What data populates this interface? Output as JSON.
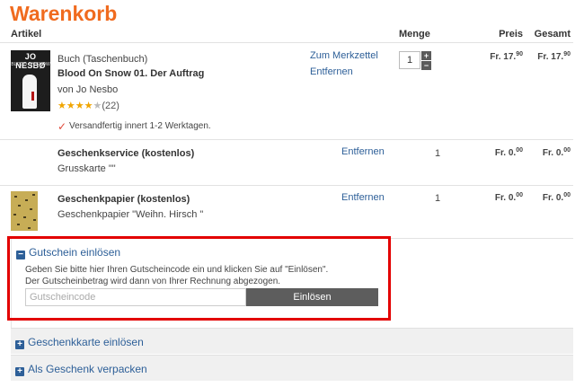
{
  "page": {
    "title": "Warenkorb"
  },
  "columns": {
    "artikel": "Artikel",
    "menge": "Menge",
    "preis": "Preis",
    "gesamt": "Gesamt"
  },
  "book": {
    "cover_author": "JO NESBØ",
    "cover_title": "BLOOD ON SNOW",
    "type": "Buch (Taschenbuch)",
    "title": "Blood On Snow 01. Der Auftrag",
    "author": "von Jo Nesbo",
    "rating": 4,
    "rating_max": 5,
    "rating_count": "(22)",
    "availability": "Versandfertig innert 1-2 Werktagen.",
    "wishlist_link": "Zum Merkzettel",
    "remove_link": "Entfernen",
    "quantity": "1",
    "price_main": "Fr. 17.",
    "price_cents": "90",
    "total_main": "Fr. 17.",
    "total_cents": "90"
  },
  "gift_service": {
    "title": "Geschenkservice (kostenlos)",
    "detail": "Grusskarte \"\"",
    "remove_link": "Entfernen",
    "quantity": "1",
    "price_main": "Fr. 0.",
    "price_cents": "00",
    "total_main": "Fr. 0.",
    "total_cents": "00"
  },
  "gift_paper": {
    "title": "Geschenkpapier (kostenlos)",
    "detail": "Geschenkpapier \"Weihn. Hirsch \"",
    "remove_link": "Entfernen",
    "quantity": "1",
    "price_main": "Fr. 0.",
    "price_cents": "00",
    "total_main": "Fr. 0.",
    "total_cents": "00"
  },
  "voucher": {
    "heading": "Gutschein einlösen",
    "hint_line1": "Geben Sie bitte hier Ihren Gutscheincode ein und klicken Sie auf \"Einlösen\".",
    "hint_line2": "Der Gutscheinbetrag wird dann von Ihrer Rechnung abgezogen.",
    "placeholder": "Gutscheincode",
    "button": "Einlösen"
  },
  "sections": {
    "gift_card": "Geschenkkarte einlösen",
    "gift_wrap": "Als Geschenk verpacken"
  },
  "colors": {
    "brand": "#f06b1f",
    "link": "#2d5f98",
    "highlight": "#e30000",
    "star": "#f0a500"
  },
  "icons": {
    "check": "check-icon",
    "minus": "minus-box-icon",
    "plus": "plus-box-icon"
  }
}
